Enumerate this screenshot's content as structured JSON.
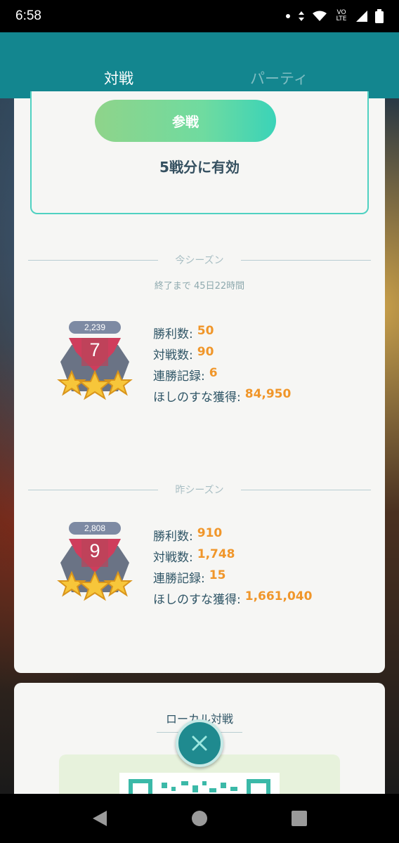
{
  "status_bar": {
    "time": "6:58",
    "volte_label": "VO LTE"
  },
  "tabs": [
    {
      "label": "対戦",
      "active": true
    },
    {
      "label": "パーティ",
      "active": false
    }
  ],
  "ticket": {
    "join_label": "参戦",
    "valid_text": "5戦分に有効"
  },
  "current_season": {
    "title": "今シーズン",
    "end_text": "終了まで 45日22時間",
    "rating": "2,239",
    "rank": "7",
    "stats": [
      {
        "label": "勝利数:",
        "value": "50"
      },
      {
        "label": "対戦数:",
        "value": "90"
      },
      {
        "label": "連勝記録:",
        "value": "6"
      },
      {
        "label": "ほしのすな獲得:",
        "value": "84,950"
      }
    ]
  },
  "previous_season": {
    "title": "昨シーズン",
    "rating": "2,808",
    "rank": "9",
    "stats": [
      {
        "label": "勝利数:",
        "value": "910"
      },
      {
        "label": "対戦数:",
        "value": "1,748"
      },
      {
        "label": "連勝記録:",
        "value": "15"
      },
      {
        "label": "ほしのすな獲得:",
        "value": "1,661,040"
      }
    ]
  },
  "local_battle": {
    "title": "ローカル対戦"
  },
  "colors": {
    "header": "#13868f",
    "accent": "#4fd1c1",
    "value": "#f0962a",
    "text": "#2f5566"
  },
  "icons": {
    "close": "close-icon",
    "back": "back-icon",
    "home": "home-icon",
    "recents": "recents-icon"
  }
}
